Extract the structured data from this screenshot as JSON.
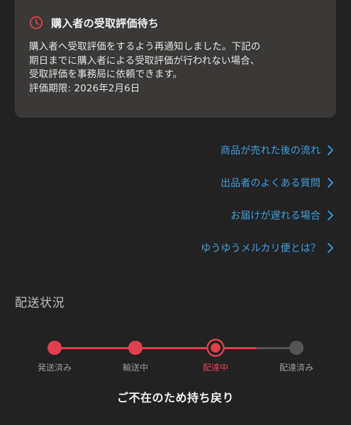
{
  "notice": {
    "title": "購入者の受取評価待ち",
    "body": "購入者へ受取評価をするよう再通知しました。下記の\n期日までに購入者による受取評価が行われない場合、\n受取評価を事務局に依頼できます。",
    "deadline": "評価期限: 2026年2月6日",
    "icon": "clock-icon",
    "icon_color": "#e0404d"
  },
  "links": [
    {
      "label": "商品が売れた後の流れ",
      "icon": "chevron-right-icon"
    },
    {
      "label": "出品者のよくある質問",
      "icon": "chevron-right-icon"
    },
    {
      "label": "お届けが遅れる場合",
      "icon": "chevron-right-icon"
    },
    {
      "label": "ゆうゆうメルカリ便とは？",
      "icon": "chevron-right-icon"
    }
  ],
  "shipping": {
    "title": "配送状況",
    "steps": [
      {
        "label": "発送済み",
        "state": "done"
      },
      {
        "label": "輸送中",
        "state": "done"
      },
      {
        "label": "配達中",
        "state": "current"
      },
      {
        "label": "配達済み",
        "state": "pending"
      }
    ],
    "status_text": "ご不在のため持ち戻り"
  },
  "colors": {
    "accent": "#e0404d",
    "link": "#3e9fe0",
    "pending": "#555555"
  }
}
